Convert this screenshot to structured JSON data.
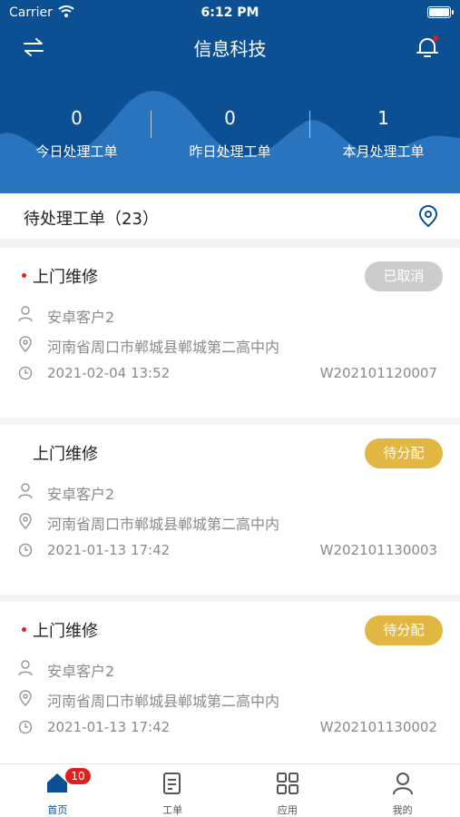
{
  "status_bar": {
    "carrier": "Carrier",
    "time": "6:12 PM"
  },
  "nav": {
    "title": "信息科技"
  },
  "stats": [
    {
      "value": "0",
      "label": "今日处理工单"
    },
    {
      "value": "0",
      "label": "昨日处理工单"
    },
    {
      "value": "1",
      "label": "本月处理工单"
    }
  ],
  "section": {
    "title": "待处理工单（23）"
  },
  "cards": [
    {
      "title": "上门维修",
      "status": "已取消",
      "customer": "安卓客户2",
      "address": "河南省周口市郸城县郸城第二高中内",
      "time": "2021-02-04 13:52",
      "order_no": "W202101120007"
    },
    {
      "title": "上门维修",
      "status": "待分配",
      "customer": "安卓客户2",
      "address": "河南省周口市郸城县郸城第二高中内",
      "time": "2021-01-13 17:42",
      "order_no": "W202101130003"
    },
    {
      "title": "上门维修",
      "status": "待分配",
      "customer": "安卓客户2",
      "address": "河南省周口市郸城县郸城第二高中内",
      "time": "2021-01-13 17:42",
      "order_no": "W202101130002"
    }
  ],
  "tabbar": {
    "items": [
      {
        "label": "首页",
        "icon": "home-icon",
        "badge": "10"
      },
      {
        "label": "工单",
        "icon": "work-order-icon"
      },
      {
        "label": "应用",
        "icon": "apps-grid-icon"
      },
      {
        "label": "我的",
        "icon": "profile-icon"
      }
    ]
  },
  "colors": {
    "primary": "#0c4f93",
    "wave": "#2a73bd",
    "pending": "#e1b742",
    "cancelled": "#cccccc",
    "alert": "#e02020"
  }
}
